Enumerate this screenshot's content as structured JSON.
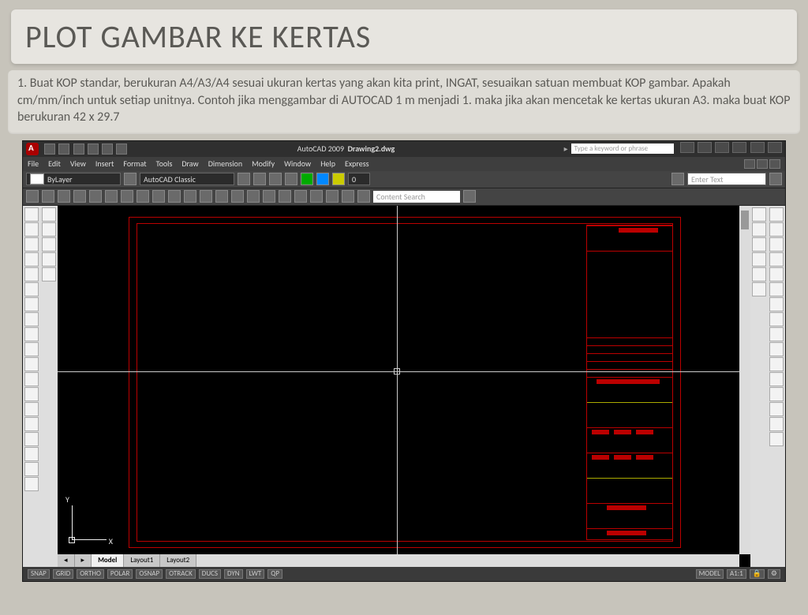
{
  "slide": {
    "title": "PLOT GAMBAR KE KERTAS",
    "body": "1. Buat KOP standar, berukuran A4/A3/A4 sesuai ukuran kertas yang akan kita print, INGAT, sesuaikan satuan membuat KOP gambar. Apakah cm/mm/inch untuk setiap unitnya. Contoh jika menggambar di AUTOCAD 1 m menjadi 1. maka jika akan mencetak ke kertas ukuran A3. maka buat KOP berukuran 42 x 29.7"
  },
  "autocad": {
    "app_name": "AutoCAD 2009",
    "doc_name": "Drawing2.dwg",
    "search_placeholder": "Type a keyword or phrase",
    "menus": [
      "File",
      "Edit",
      "View",
      "Insert",
      "Format",
      "Tools",
      "Draw",
      "Dimension",
      "Modify",
      "Window",
      "Help",
      "Express"
    ],
    "props": {
      "layer": "ByLayer",
      "workspace": "AutoCAD Classic",
      "content_search_ph": "Content Search",
      "enter_text_ph": "Enter Text",
      "zero": "0"
    },
    "tabs": {
      "model": "Model",
      "layout1": "Layout1",
      "layout2": "Layout2"
    },
    "ucs": {
      "x": "X",
      "y": "Y"
    },
    "status": {
      "buttons": [
        "SNAP",
        "GRID",
        "ORTHO",
        "POLAR",
        "OSNAP",
        "OTRACK",
        "DUCS",
        "DYN",
        "LWT",
        "QP"
      ],
      "scale": "A1:1",
      "model_btn": "MODEL"
    }
  }
}
